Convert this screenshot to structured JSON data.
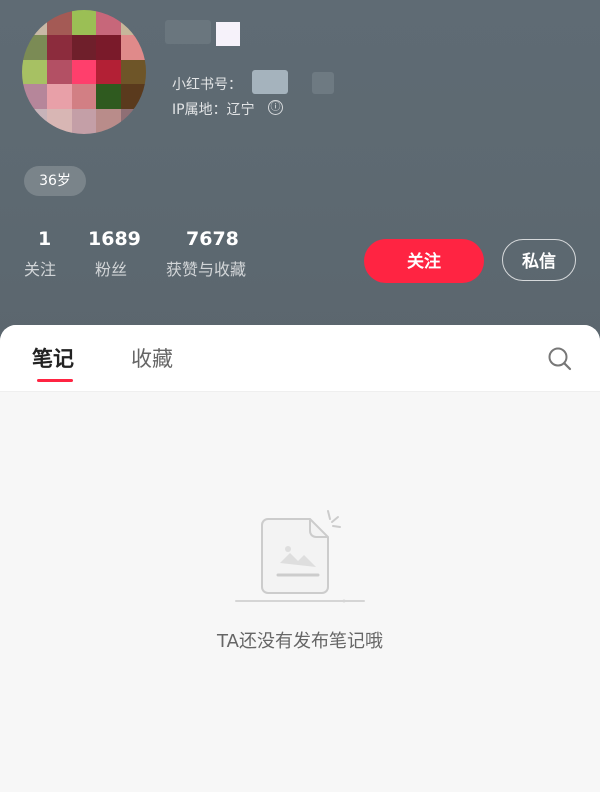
{
  "profile": {
    "redbook_id_label": "小红书号：",
    "ip_label": "IP属地：辽宁",
    "info_icon": "ⓘ",
    "age_tag": "36岁"
  },
  "stats": [
    {
      "value": "1",
      "label": "关注"
    },
    {
      "value": "1689",
      "label": "粉丝"
    },
    {
      "value": "7678",
      "label": "获赞与收藏"
    }
  ],
  "actions": {
    "follow_label": "关注",
    "message_label": "私信"
  },
  "tabs": [
    {
      "label": "笔记",
      "active": true
    },
    {
      "label": "收藏",
      "active": false
    }
  ],
  "empty_state": {
    "text": "TA还没有发布笔记哦",
    "icon": "empty-notes-icon"
  },
  "colors": {
    "accent": "#ff2442",
    "header_bg": "#5f6b74"
  }
}
